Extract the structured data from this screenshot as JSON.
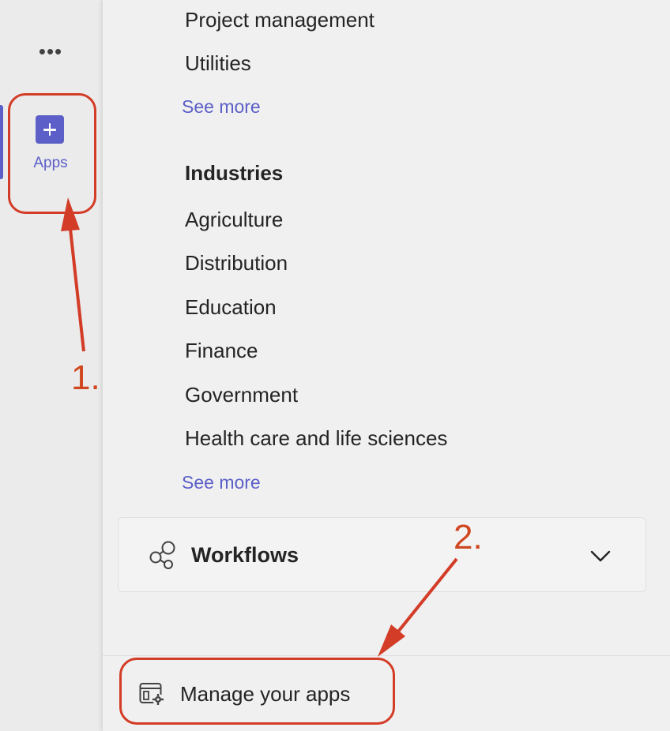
{
  "rail": {
    "more_label": "•••",
    "apps_label": "Apps",
    "accent": "#5b5fc7"
  },
  "panel": {
    "top_items": [
      "Project management",
      "Utilities"
    ],
    "see_more_1": "See more",
    "industries_heading": "Industries",
    "industries": [
      "Agriculture",
      "Distribution",
      "Education",
      "Finance",
      "Government",
      "Health care and life sciences"
    ],
    "see_more_2": "See more",
    "workflows_label": "Workflows",
    "manage_label": "Manage your apps"
  },
  "annotations": {
    "step1": "1.",
    "step2": "2.",
    "color": "#d33c27"
  }
}
